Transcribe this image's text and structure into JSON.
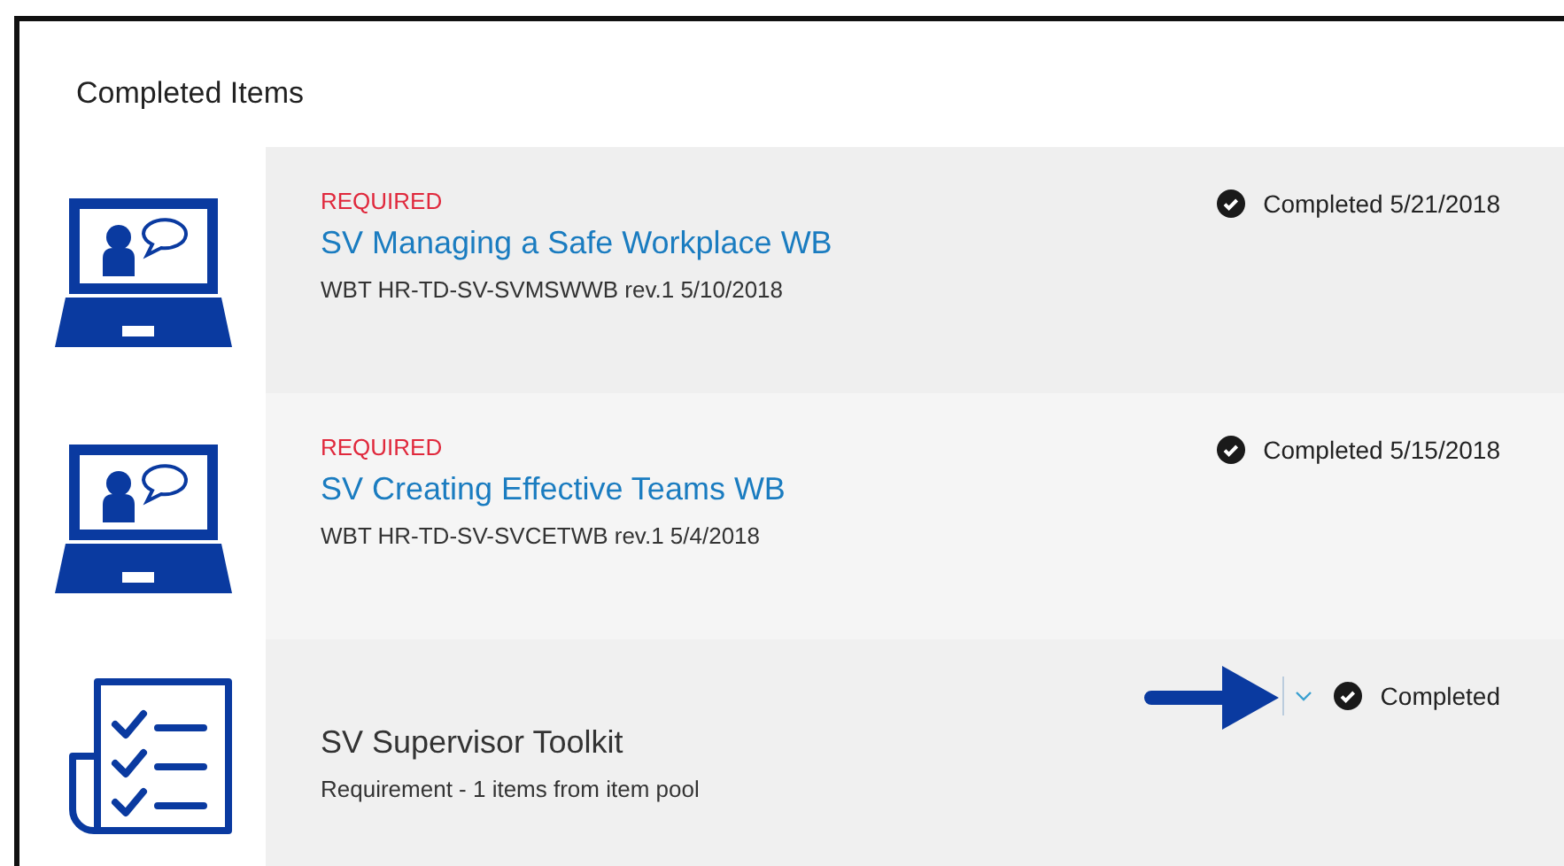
{
  "section": {
    "title": "Completed Items"
  },
  "items": [
    {
      "kind": "laptop",
      "label": "REQUIRED",
      "title": "SV Managing a Safe Workplace WB",
      "title_is_link": true,
      "subtitle": "WBT HR-TD-SV-SVMSWWB rev.1 5/10/2018",
      "status": "Completed 5/21/2018",
      "expandable": false,
      "arrow_callout": false
    },
    {
      "kind": "laptop",
      "label": "REQUIRED",
      "title": "SV Creating Effective Teams WB",
      "title_is_link": true,
      "subtitle": "WBT HR-TD-SV-SVCETWB rev.1 5/4/2018",
      "status": "Completed 5/15/2018",
      "expandable": false,
      "arrow_callout": false
    },
    {
      "kind": "checklist",
      "title": "SV Supervisor Toolkit",
      "title_is_link": false,
      "subtitle": "Requirement - 1 items from item pool",
      "status": "Completed",
      "expandable": true,
      "arrow_callout": true
    }
  ]
}
